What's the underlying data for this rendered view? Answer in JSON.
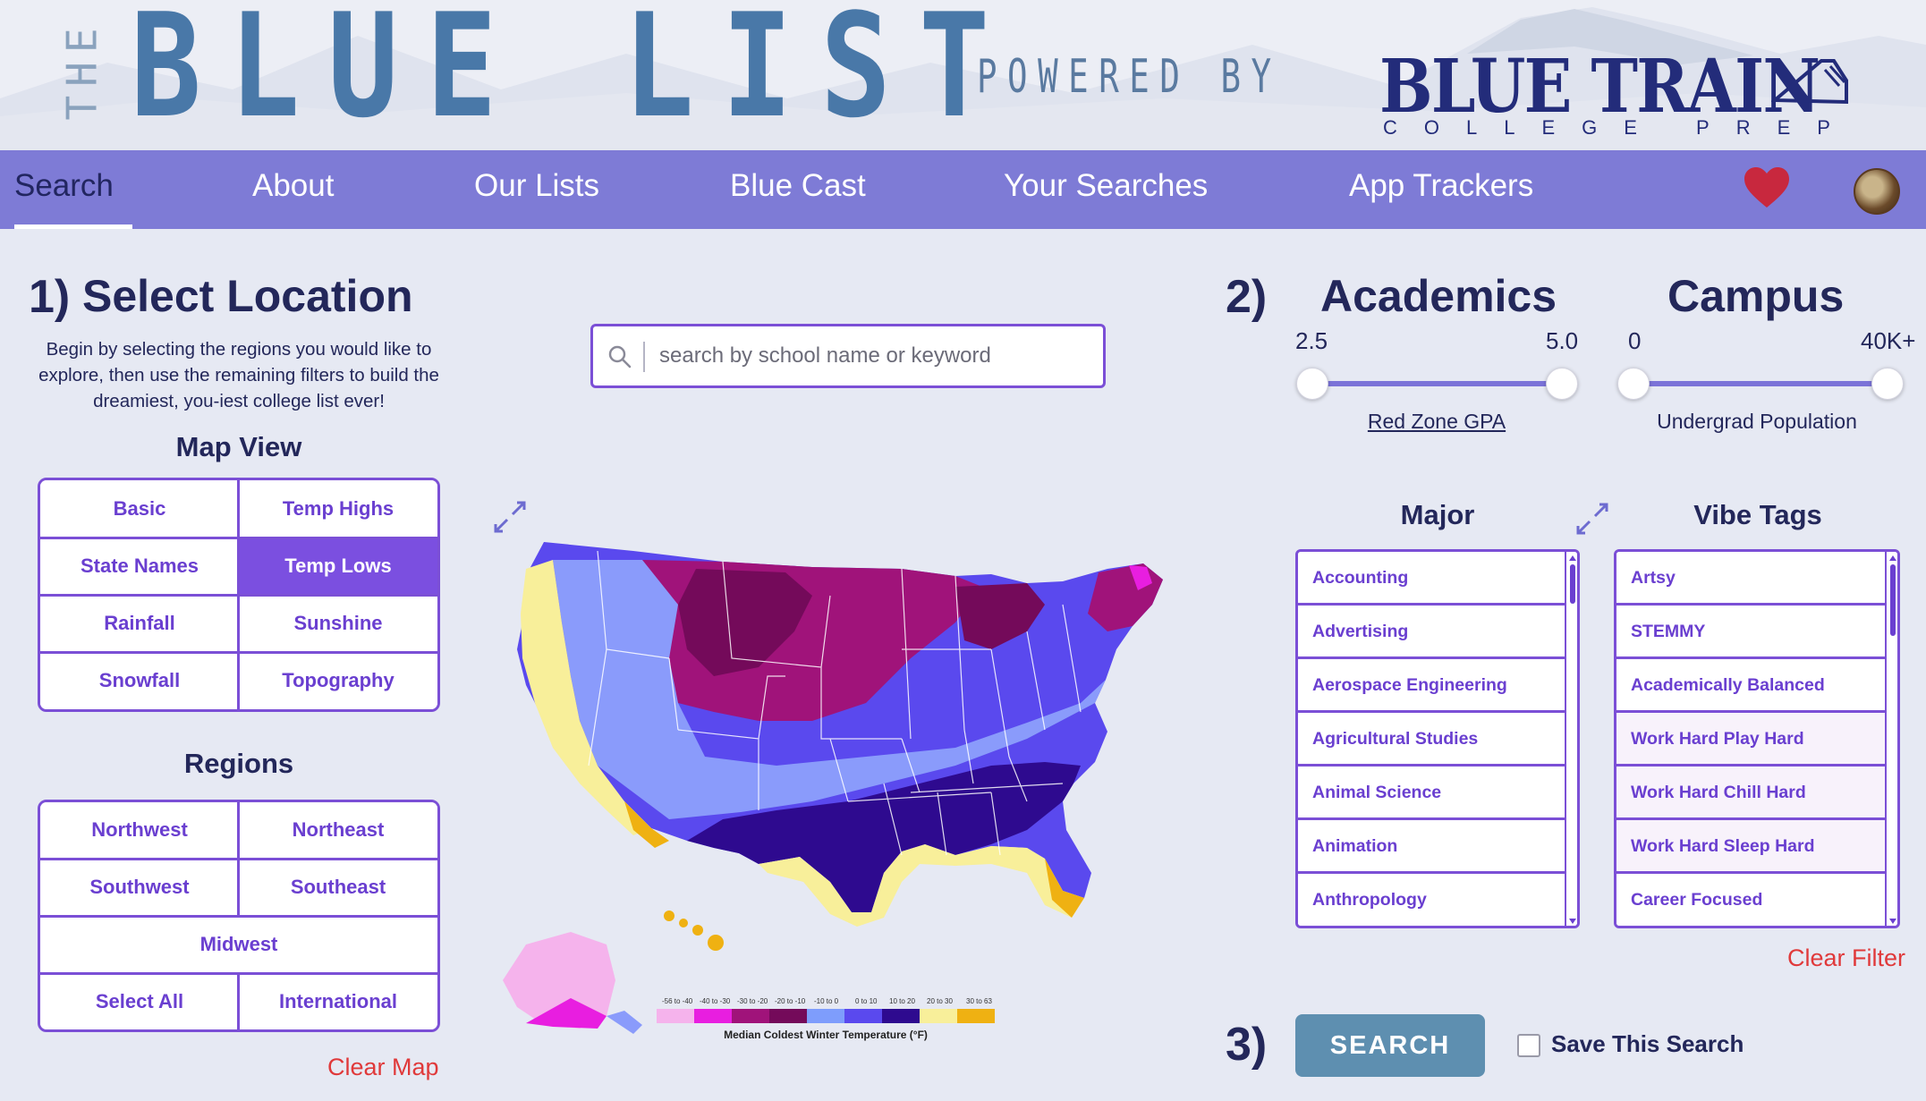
{
  "header": {
    "logo_the": "THE",
    "logo_title": "BLUE LIST",
    "powered_by": "POWERED BY",
    "partner_name": "BLUE TRAIN",
    "partner_sub": "COLLEGE PREP"
  },
  "nav": {
    "items": [
      {
        "label": "Search",
        "active": true
      },
      {
        "label": "About"
      },
      {
        "label": "Our Lists"
      },
      {
        "label": "Blue Cast"
      },
      {
        "label": "Your Searches"
      },
      {
        "label": "App Trackers"
      }
    ],
    "favorites_icon": "heart-icon",
    "accent_color": "#7e7bd6",
    "heart_color": "#c8283e"
  },
  "location": {
    "step": "1)",
    "title": "Select Location",
    "intro": "Begin by selecting the regions you would like to explore, then use the remaining filters to build the dreamiest, you-iest college list ever!",
    "map_view_title": "Map View",
    "map_views": [
      "Basic",
      "Temp Highs",
      "State Names",
      "Temp Lows",
      "Rainfall",
      "Sunshine",
      "Snowfall",
      "Topography"
    ],
    "selected_map_view": "Temp Lows",
    "regions_title": "Regions",
    "regions": [
      "Northwest",
      "Northeast",
      "Southwest",
      "Southeast",
      "Midwest",
      "Select All",
      "International"
    ],
    "clear_map": "Clear Map"
  },
  "search": {
    "placeholder": "search by school name or keyword",
    "icon": "search-icon"
  },
  "map": {
    "legend_title": "Median Coldest Winter Temperature (°F)",
    "legend": [
      {
        "label": "-56 to -40",
        "color": "#f5b3ec"
      },
      {
        "label": "-40 to -30",
        "color": "#e81ee0"
      },
      {
        "label": "-30 to -20",
        "color": "#a0137a"
      },
      {
        "label": "-20 to -10",
        "color": "#740a5a"
      },
      {
        "label": "-10 to 0",
        "color": "#7e9dfc"
      },
      {
        "label": "0 to 10",
        "color": "#8a9bfb"
      },
      {
        "label": "10 to 20",
        "color": "#5a49ee"
      },
      {
        "label": "20 to 30",
        "color": "#2e0a8f"
      },
      {
        "label": "30 to 63",
        "color": "#f8ef9a"
      },
      {
        "label": "",
        "color": "#efb112"
      }
    ]
  },
  "academics": {
    "step": "2)",
    "title": "Academics",
    "min": "2.5",
    "max": "5.0",
    "label": "Red Zone GPA",
    "major_title": "Major",
    "majors": [
      "Accounting",
      "Advertising",
      "Aerospace Engineering",
      "Agricultural Studies",
      "Animal Science",
      "Animation",
      "Anthropology"
    ]
  },
  "campus": {
    "title": "Campus",
    "min": "0",
    "max": "40K+",
    "label": "Undergrad Population",
    "vibe_title": "Vibe Tags",
    "vibes": [
      "Artsy",
      "STEMMY",
      "Academically Balanced",
      "Work Hard Play Hard",
      "Work Hard Chill Hard",
      "Work Hard Sleep Hard",
      "Career Focused"
    ],
    "clear_filter": "Clear Filter"
  },
  "submit": {
    "step": "3)",
    "button": "SEARCH",
    "save_label": "Save This Search",
    "button_color": "#5e8fb0"
  }
}
